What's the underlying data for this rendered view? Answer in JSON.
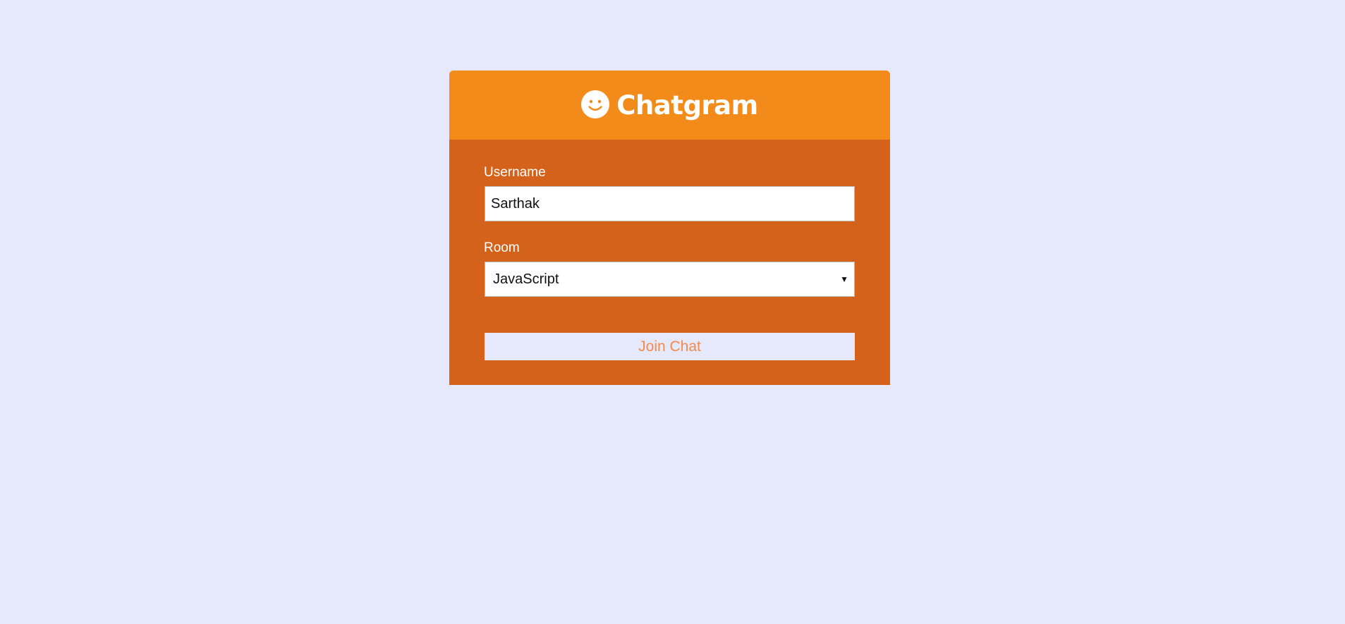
{
  "header": {
    "logo_icon": "smiley-face-icon",
    "title": "Chatgram",
    "background_color": "#f28b1a"
  },
  "form": {
    "background_color": "#d4621b",
    "username": {
      "label": "Username",
      "value": "Sarthak"
    },
    "room": {
      "label": "Room",
      "selected": "JavaScript"
    },
    "submit_label": "Join Chat"
  },
  "page": {
    "background_color": "#e6e8fc"
  }
}
